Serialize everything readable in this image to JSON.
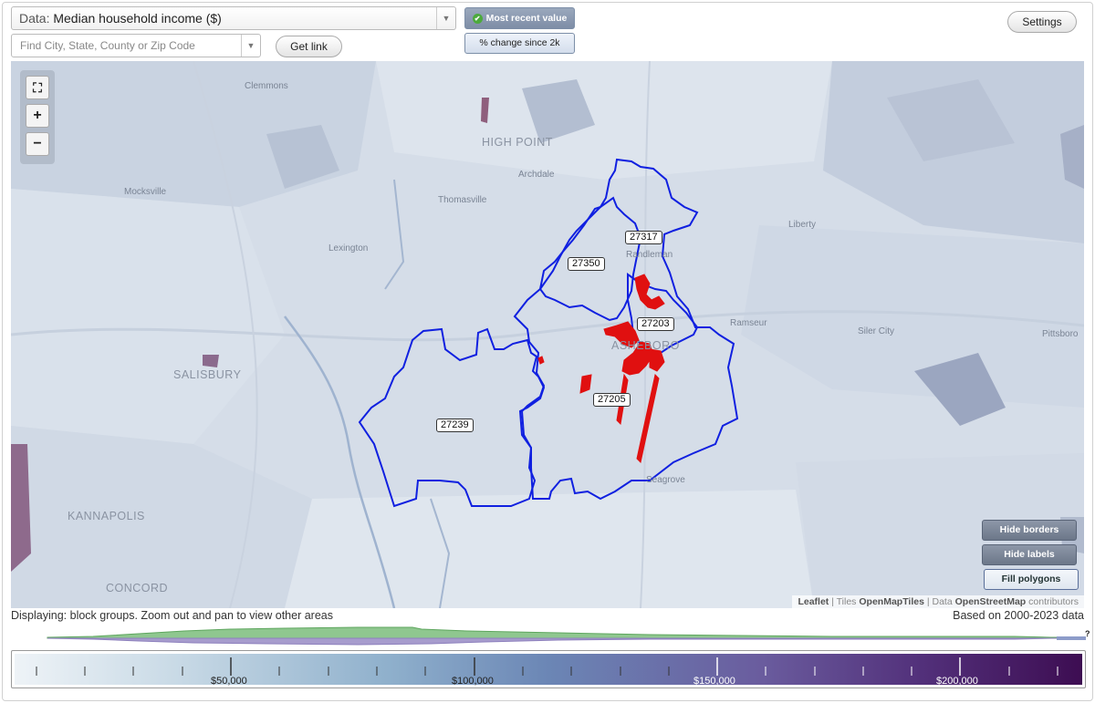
{
  "data_select": {
    "label": "Data:",
    "value": "Median household income ($)"
  },
  "search": {
    "placeholder": "Find City, State, County or Zip Code"
  },
  "buttons": {
    "get_link": "Get link",
    "most_recent": "Most recent value",
    "pct_change": "% change since 2k",
    "settings": "Settings"
  },
  "zoom": {
    "fit": "⛶",
    "in": "+",
    "out": "−"
  },
  "map_buttons": {
    "hide_borders": "Hide borders",
    "hide_labels": "Hide labels",
    "fill_polygons": "Fill polygons"
  },
  "attribution": {
    "leaflet": "Leaflet",
    "sep1": " | Tiles ",
    "tiles": "OpenMapTiles",
    "sep2": " | Data ",
    "osm": "OpenStreetMap",
    "contrib": " contributors"
  },
  "places": {
    "clemmons": "Clemmons",
    "high_point": "HIGH POINT",
    "archdale": "Archdale",
    "thomasville": "Thomasville",
    "mocksville": "Mocksville",
    "lexington": "Lexington",
    "liberty": "Liberty",
    "randleman": "Randleman",
    "ramseur": "Ramseur",
    "siler_city": "Siler City",
    "pittsboro": "Pittsboro",
    "salisbury": "SALISBURY",
    "asheboro": "ASHEBORO",
    "seagrove": "Seagrove",
    "kannapolis": "KANNAPOLIS",
    "concord": "CONCORD"
  },
  "zips": {
    "z27317": "27317",
    "z27350": "27350",
    "z27203": "27203",
    "z27205": "27205",
    "z27239": "27239"
  },
  "status": {
    "displaying": "Displaying: block groups. Zoom out and pan to view other areas",
    "based_on": "Based on 2000-2023 data"
  },
  "legend": {
    "help": "?",
    "ticks": [
      "$50,000",
      "$100,000",
      "$150,000",
      "$200,000"
    ]
  },
  "colors": {
    "boundary": "#1020e0",
    "highlight": "#e00000",
    "map_base": "#dbe3ec"
  }
}
